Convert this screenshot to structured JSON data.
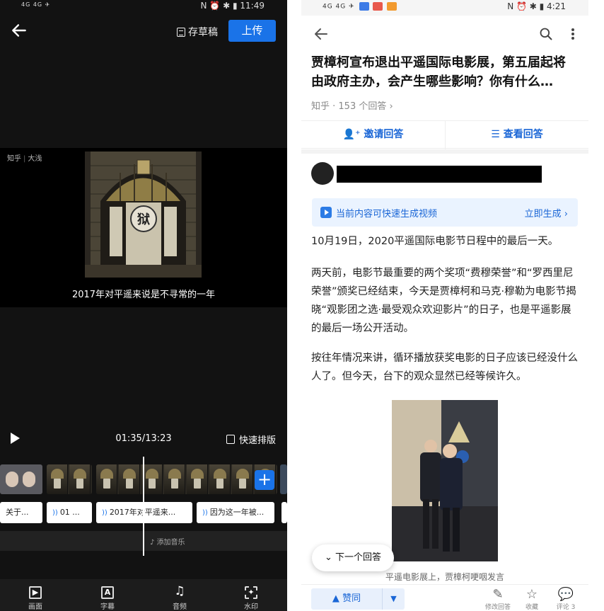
{
  "left": {
    "status_bar": {
      "left_icons": "4G 4G ✈",
      "time": "11:49",
      "right_icons": "N ⏰ ✱ ▮"
    },
    "draft_label": "存草稿",
    "upload_label": "上传",
    "watermark": {
      "brand": "知乎",
      "author": "大浅"
    },
    "caption": "2017年对平遥来说是不寻常的一年",
    "timecode": "01:35/13:23",
    "quick_layout_label": "快速排版",
    "subtitles": [
      "关于...",
      "01 ...",
      "2017年对平遥来...",
      "因为这一年被..."
    ],
    "add_music_label": "添加音乐",
    "nav": [
      {
        "label": "画面",
        "icon": "frame-icon"
      },
      {
        "label": "字幕",
        "icon": "text-icon"
      },
      {
        "label": "音频",
        "icon": "music-icon"
      },
      {
        "label": "水印",
        "icon": "watermark-icon"
      }
    ]
  },
  "right": {
    "status_bar": {
      "time": "4:21"
    },
    "question_title": "贾樟柯宣布退出平遥国际电影展，第五届起将由政府主办，会产生哪些影响？你有什么…",
    "meta": "知乎 · 153 个回答 ›",
    "invite_label": "邀请回答",
    "view_label": "查看回答",
    "gen_video": {
      "text": "当前内容可快速生成视频",
      "action": "立即生成 ›"
    },
    "paragraphs": [
      "10月19日，2020平遥国际电影节日程中的最后一天。",
      "两天前，电影节最重要的两个奖项“费穆荣誉”和“罗西里尼荣誉”颁奖已经结束，今天是贾樟柯和马克·穆勒为电影节揭晓“观影团之选·最受观众欢迎影片”的日子，也是平遥影展的最后一场公开活动。",
      "按往年情况来讲，循环播放获奖电影的日子应该已经没什么人了。但今天，台下的观众显然已经等候许久。"
    ],
    "figure_caption": "平遥电影展上，贾樟柯哽咽发言",
    "next_answer_label": "下一个回答",
    "bottom": {
      "upvote_label": "赞同",
      "edit_label": "修改回答",
      "fav_label": "收藏",
      "comment_label": "评论 3"
    }
  },
  "colors": {
    "primary_blue": "#1a73e8",
    "zhihu_blue": "#1a66d6"
  }
}
